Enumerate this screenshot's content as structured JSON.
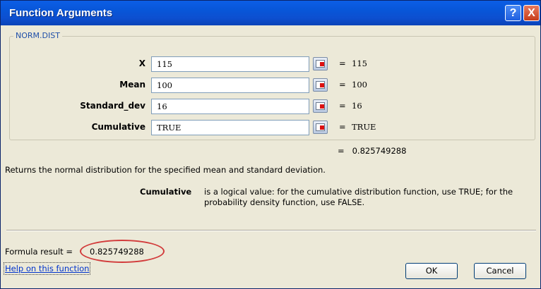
{
  "window": {
    "title": "Function Arguments"
  },
  "titlebar": {
    "help_glyph": "?",
    "close_glyph": "X"
  },
  "function_name": "NORM.DIST",
  "arguments": [
    {
      "label": "X",
      "value": "115",
      "evaluated": "115"
    },
    {
      "label": "Mean",
      "value": "100",
      "evaluated": "100"
    },
    {
      "label": "Standard_dev",
      "value": "16",
      "evaluated": "16"
    },
    {
      "label": "Cumulative",
      "value": "TRUE",
      "evaluated": "TRUE"
    }
  ],
  "equals_sign": "=",
  "overall_result": "0.825749288",
  "description": "Returns the normal distribution for the specified mean and standard deviation.",
  "param_help": {
    "name": "Cumulative",
    "text": "is a logical value: for the cumulative distribution function, use TRUE; for the probability density function, use FALSE."
  },
  "formula_result": {
    "label": "Formula result =",
    "value": "0.825749288"
  },
  "help_link": "Help on this function",
  "buttons": {
    "ok": "OK",
    "cancel": "Cancel"
  },
  "colors": {
    "titlebar": "#0856d8",
    "dialog_bg": "#ece9d8",
    "highlight": "#d23b3b",
    "link": "#0033cc"
  }
}
